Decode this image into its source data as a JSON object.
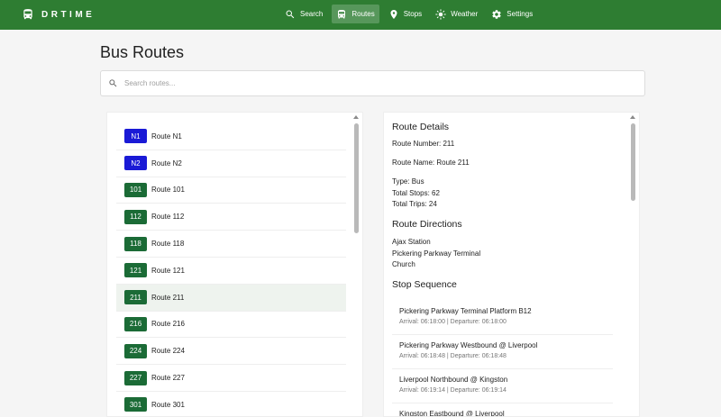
{
  "app": {
    "brand": "DRTIME",
    "nav": [
      {
        "label": "Search",
        "icon": "search-icon"
      },
      {
        "label": "Routes",
        "icon": "bus-icon"
      },
      {
        "label": "Stops",
        "icon": "location-pin-icon"
      },
      {
        "label": "Weather",
        "icon": "sun-icon"
      },
      {
        "label": "Settings",
        "icon": "gear-icon"
      }
    ],
    "active_nav": "Routes"
  },
  "page": {
    "title": "Bus Routes"
  },
  "search": {
    "placeholder": "Search routes..."
  },
  "routes": [
    {
      "number": "N1",
      "name": "Route N1",
      "color": "#1a1ad6"
    },
    {
      "number": "N2",
      "name": "Route N2",
      "color": "#1a1ad6"
    },
    {
      "number": "101",
      "name": "Route 101",
      "color": "#1b6b36"
    },
    {
      "number": "112",
      "name": "Route 112",
      "color": "#1b6b36"
    },
    {
      "number": "118",
      "name": "Route 118",
      "color": "#1b6b36"
    },
    {
      "number": "121",
      "name": "Route 121",
      "color": "#1b6b36"
    },
    {
      "number": "211",
      "name": "Route 211",
      "color": "#1b6b36"
    },
    {
      "number": "216",
      "name": "Route 216",
      "color": "#1b6b36"
    },
    {
      "number": "224",
      "name": "Route 224",
      "color": "#1b6b36"
    },
    {
      "number": "227",
      "name": "Route 227",
      "color": "#1b6b36"
    },
    {
      "number": "301",
      "name": "Route 301",
      "color": "#1b6b36"
    }
  ],
  "selected_route": "211",
  "details": {
    "heading": "Route Details",
    "route_number": "Route Number: 211",
    "route_name": "Route Name: Route 211",
    "type": "Type: Bus",
    "total_stops": "Total Stops: 62",
    "total_trips": "Total Trips: 24",
    "directions_heading": "Route Directions",
    "directions": [
      "Ajax Station",
      "Pickering Parkway Terminal",
      "Church"
    ],
    "stops_heading": "Stop Sequence",
    "stops": [
      {
        "name": "Pickering Parkway Terminal Platform B12",
        "times": "Arrival: 06:18:00 | Departure: 06:18:00"
      },
      {
        "name": "Pickering Parkway Westbound @ Liverpool",
        "times": "Arrival: 06:18:48 | Departure: 06:18:48"
      },
      {
        "name": "Liverpool Northbound @ Kingston",
        "times": "Arrival: 06:19:14 | Departure: 06:19:14"
      },
      {
        "name": "Kingston Eastbound @ Liverpool",
        "times": ""
      }
    ]
  },
  "colors": {
    "header": "#2e7d32",
    "badge_night": "#1a1ad6",
    "badge_day": "#1b6b36",
    "selected_row": "#eef3ee"
  }
}
